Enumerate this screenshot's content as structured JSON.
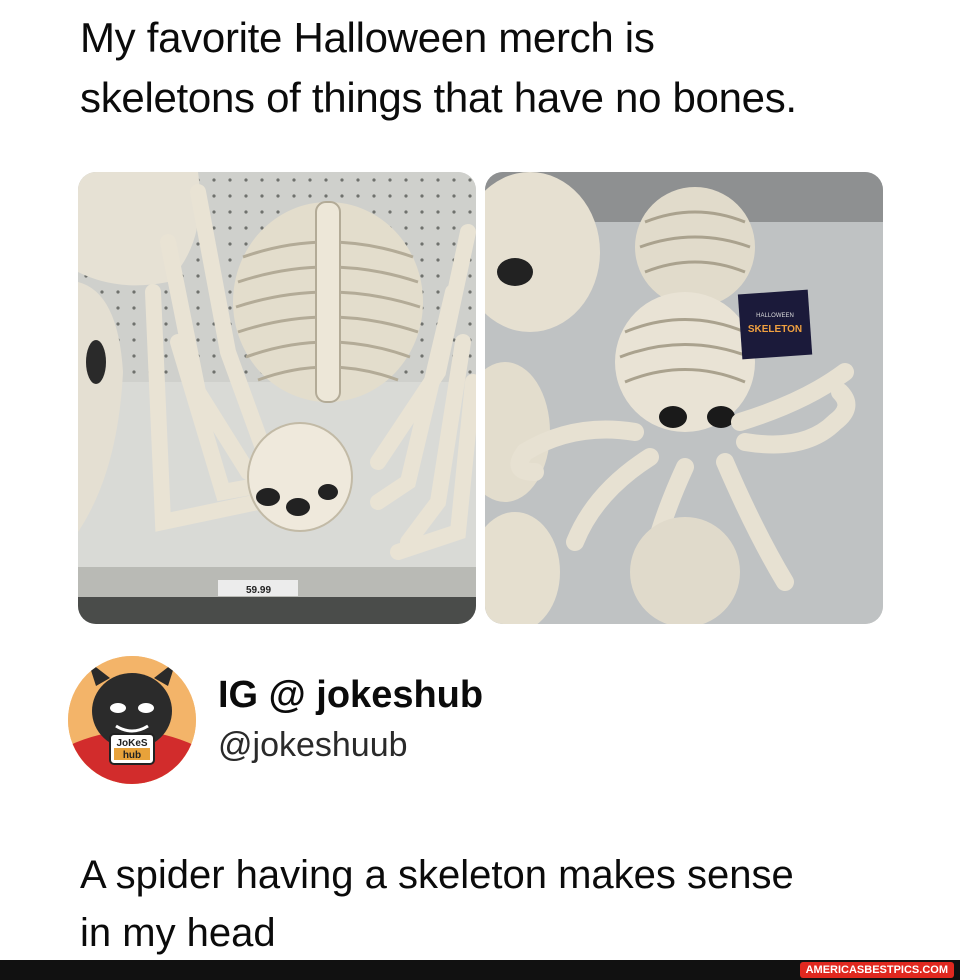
{
  "post": {
    "text_line1": "My favorite Halloween merch is",
    "text_line2": "skeletons of things that have no bones."
  },
  "photos": {
    "left": {
      "icon": "spider-skeleton-photo",
      "price_tag": "59.99"
    },
    "right": {
      "icon": "octopus-skeleton-photo",
      "label_line1": "HALLOWEEN",
      "label_line2": "SKELETON"
    }
  },
  "quote": {
    "avatar_label_line1": "JoKeS",
    "avatar_label_line2": "hub",
    "name": "IG @ jokeshub",
    "handle": "@jokeshuub",
    "text_line1": "A spider having a skeleton makes sense",
    "text_line2": "in my head"
  },
  "footer": {
    "watermark": "AMERICASBESTPICS.COM"
  },
  "colors": {
    "background": "#ffffff",
    "text": "#0b0b0b",
    "footer": "#111111",
    "watermark_bg": "#e0281f"
  }
}
